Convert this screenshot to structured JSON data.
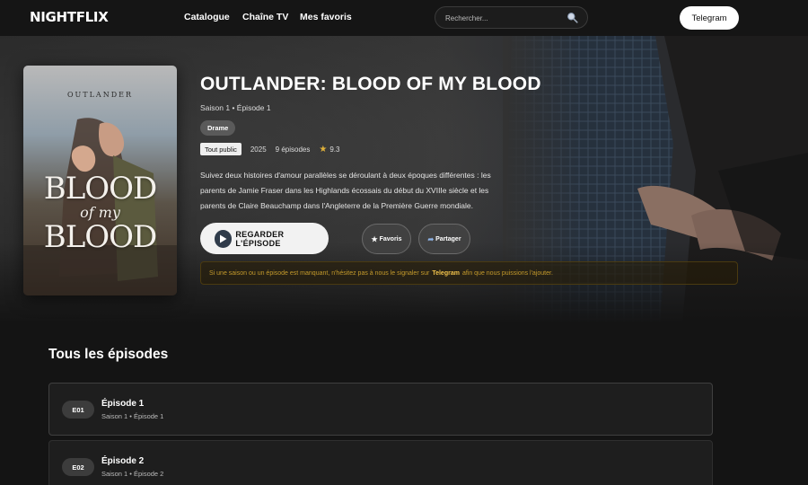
{
  "header": {
    "logo": "NIGHTFLIX",
    "nav": [
      "Catalogue",
      "Chaîne TV",
      "Mes favoris"
    ],
    "search_placeholder": "Rechercher...",
    "telegram_label": "Telegram"
  },
  "show": {
    "poster": {
      "brand": "OUTLANDER",
      "title_line1": "BLOOD",
      "title_line2": "of my",
      "title_line3": "BLOOD"
    },
    "title": "OUTLANDER: BLOOD OF MY BLOOD",
    "subtitle": "Saison 1 • Épisode 1",
    "genre": "Drame",
    "age_rating": "Tout public",
    "year": "2025",
    "episode_count": "9 épisodes",
    "score": "9.3",
    "description": "Suivez deux histoires d'amour parallèles se déroulant à deux époques différentes : les parents de Jamie Fraser dans les Highlands écossais du début du XVIIIe siècle et les parents de Claire Beauchamp dans l'Angleterre de la Première Guerre mondiale.",
    "play_label": "REGARDER L'ÉPISODE",
    "favorite_label": "Favoris",
    "share_label": "Partager",
    "notice_before": "Si une saison ou un épisode est manquant, n'hésitez pas à nous le signaler sur",
    "notice_link": "Telegram",
    "notice_after": "afin que nous puissions l'ajouter."
  },
  "episodes_section": {
    "title": "Tous les épisodes",
    "items": [
      {
        "code": "E01",
        "name": "Épisode 1",
        "meta": "Saison 1 • Épisode 1"
      },
      {
        "code": "E02",
        "name": "Épisode 2",
        "meta": "Saison 1 • Épisode 2"
      }
    ]
  },
  "colors": {
    "background": "#141414",
    "accent_gold": "#e0b13a",
    "notice_text": "#c49a2b"
  }
}
